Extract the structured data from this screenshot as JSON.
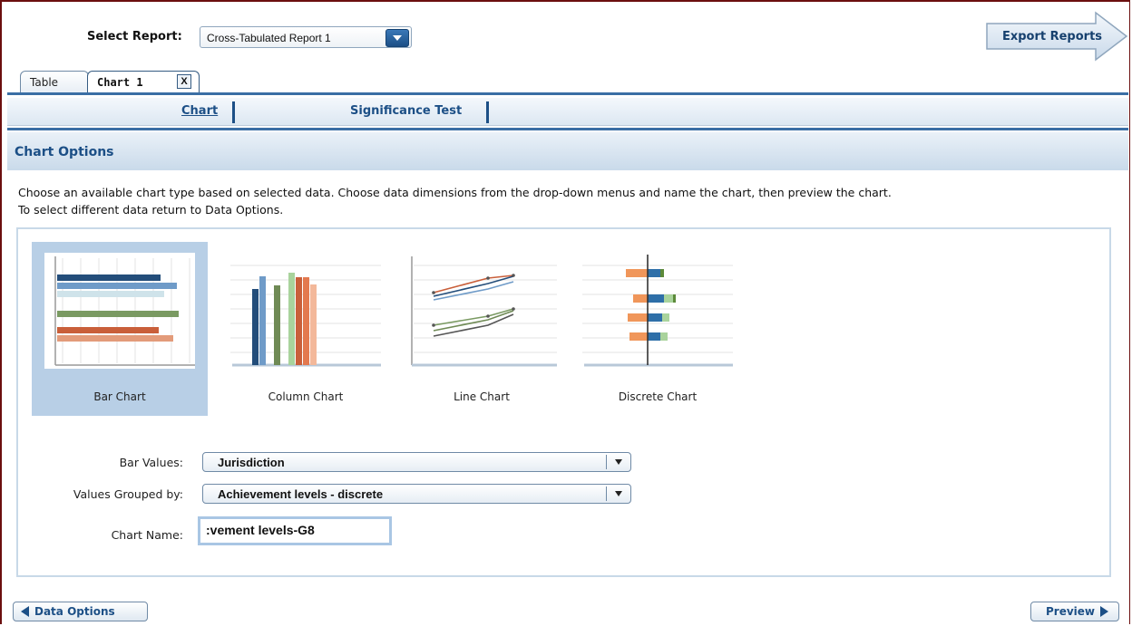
{
  "header": {
    "select_report_label": "Select Report:",
    "selected_report": "Cross-Tabulated Report 1",
    "export_label": "Export Reports"
  },
  "tabs": [
    {
      "label": "Table",
      "active": false
    },
    {
      "label": "Chart 1",
      "active": true,
      "close": "X"
    }
  ],
  "subnav": [
    {
      "label": "Chart",
      "active": true
    },
    {
      "label": "Significance Test",
      "active": false
    }
  ],
  "section": {
    "title": "Chart Options",
    "intro_line1": "Choose an available chart type based on selected data. Choose data dimensions from the drop-down menus and name the chart, then preview the chart.",
    "intro_line2": "To select different data return to Data Options."
  },
  "chart_types": [
    {
      "label": "Bar Chart",
      "selected": true
    },
    {
      "label": "Column Chart",
      "selected": false
    },
    {
      "label": "Line Chart",
      "selected": false
    },
    {
      "label": "Discrete Chart",
      "selected": false
    }
  ],
  "form": {
    "bar_values_label": "Bar Values:",
    "bar_values": "Jurisdiction",
    "grouped_by_label": "Values Grouped by:",
    "grouped_by": "Achievement levels - discrete",
    "chart_name_label": "Chart Name:",
    "chart_name": ":vement levels-G8"
  },
  "footer": {
    "back_label": "Data Options",
    "preview_label": "Preview"
  },
  "colors": {
    "accent_blue": "#1c4f86",
    "selected_bg": "#b8cfe6",
    "frame": "#6b0f0f"
  }
}
